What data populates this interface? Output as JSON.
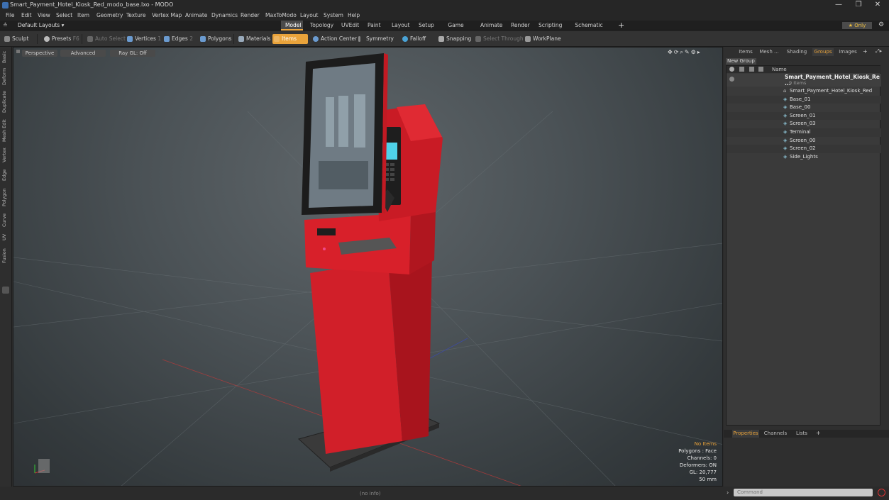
{
  "window": {
    "title": "Smart_Payment_Hotel_Kiosk_Red_modo_base.lxo - MODO",
    "minimize": "—",
    "restore": "❐",
    "close": "✕"
  },
  "menubar": [
    "File",
    "Edit",
    "View",
    "Select",
    "Item",
    "Geometry",
    "Texture",
    "Vertex Map",
    "Animate",
    "Dynamics",
    "Render",
    "MaxToModo",
    "Layout",
    "System",
    "Help"
  ],
  "layoutbar": {
    "layouts_label": "Default Layouts ▾",
    "tabs": [
      "Model",
      "Topology",
      "UVEdit",
      "Paint",
      "Layout",
      "Setup",
      "Game Tools",
      "Animate",
      "Render",
      "Scripting",
      "Schematic Fusion"
    ],
    "active_tab": "Model",
    "add": "+",
    "only_label": "★ Only",
    "settings": "⚙"
  },
  "toolbar": {
    "sculpt": "Sculpt",
    "presets": "Presets",
    "presets_key": "F6",
    "auto_select": "Auto Select",
    "vertices": "Vertices",
    "vertices_key": "1",
    "edges": "Edges",
    "edges_key": "2",
    "polygons": "Polygons",
    "materials": "Materials",
    "items": "Items",
    "action_center": "Action Center",
    "symmetry": "Symmetry",
    "falloff": "Falloff",
    "snapping": "Snapping",
    "select_through": "Select Through",
    "workplane": "WorkPlane"
  },
  "leftbar": [
    "Basic",
    "Deform",
    "Duplicate",
    "Mesh Edit",
    "Vertex",
    "Edge",
    "Polygon",
    "Curve",
    "UV",
    "Fusion"
  ],
  "viewport": {
    "perspective": "Perspective",
    "advanced": "Advanced",
    "raygl": "Ray GL: Off",
    "stats": [
      "No Items",
      "Polygons : Face",
      "Channels: 0",
      "Deformers: ON",
      "GL: 20,777",
      "50 mm"
    ],
    "status": "(no info)"
  },
  "rightpanel": {
    "tabs": [
      "Items",
      "Mesh ...",
      "Shading",
      "Groups",
      "Images"
    ],
    "active_tab": "Groups",
    "new_group": "New Group",
    "name_header": "Name",
    "group_name": "Smart_Payment_Hotel_Kiosk_Re ...",
    "group_count": "9 Items",
    "items": [
      "Smart_Payment_Hotel_Kiosk_Red",
      "Base_01",
      "Base_00",
      "Screen_01",
      "Screen_03",
      "Terminal",
      "Screen_00",
      "Screen_02",
      "Side_Lights"
    ],
    "bottom_tabs": [
      "Properties",
      "Channels",
      "Lists"
    ],
    "bottom_active": "Properties",
    "command_placeholder": "Command"
  },
  "colors": {
    "accent": "#e9a33b",
    "kiosk_red": "#d8202a",
    "viewport_bg": "#4b5256"
  }
}
